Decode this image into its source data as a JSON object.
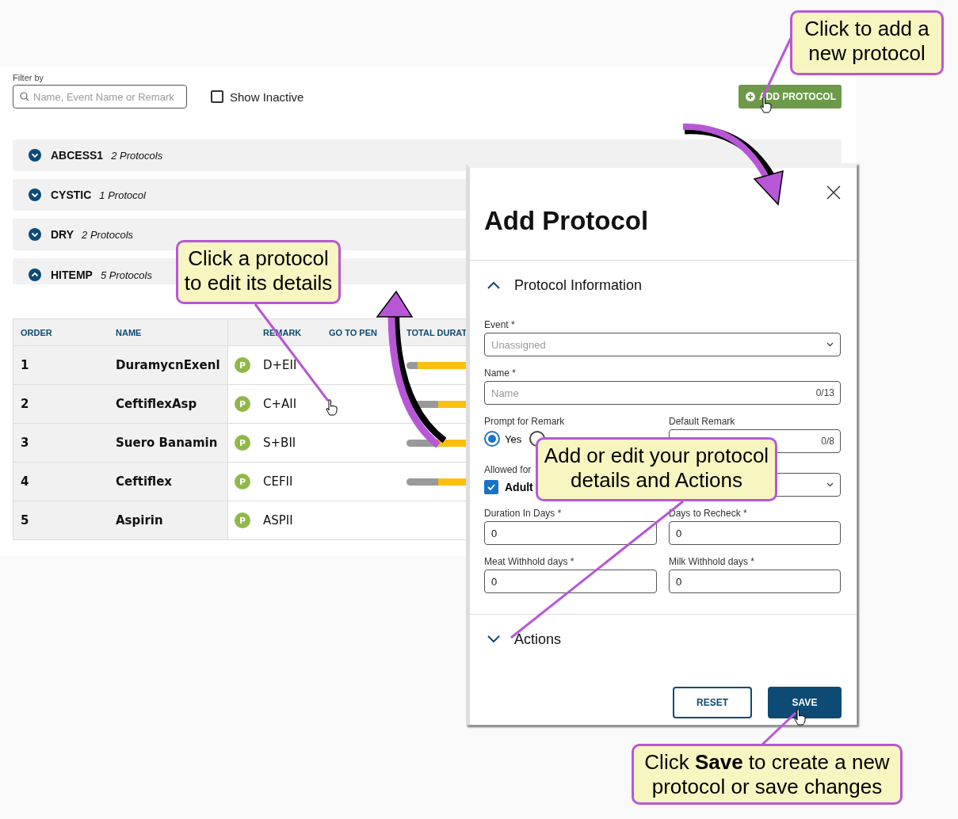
{
  "filter": {
    "label": "Filter by",
    "placeholder": "Name, Event Name or Remark"
  },
  "show_inactive": {
    "label": "Show Inactive",
    "checked": false
  },
  "add_button": "ADD PROTOCOL",
  "groups": [
    {
      "name": "ABCESS1",
      "count": "2 Protocols",
      "expanded": false
    },
    {
      "name": "CYSTIC",
      "count": "1 Protocol",
      "expanded": false
    },
    {
      "name": "DRY",
      "count": "2 Protocols",
      "expanded": false
    },
    {
      "name": "HITEMP",
      "count": "5 Protocols",
      "expanded": true
    }
  ],
  "table": {
    "columns": [
      "ORDER",
      "NAME",
      "REMARK",
      "GO TO PEN",
      "TOTAL DURAT"
    ],
    "rows": [
      {
        "order": "1",
        "name": "DuramycnExenl",
        "badge": "P",
        "remark": "D+EII",
        "duration_bar": true
      },
      {
        "order": "2",
        "name": "CeftiflexAsp",
        "badge": "P",
        "remark": "C+AII",
        "duration_bar": true
      },
      {
        "order": "3",
        "name": "Suero Banamin",
        "badge": "P",
        "remark": "S+BII",
        "duration_bar": true
      },
      {
        "order": "4",
        "name": "Ceftiflex",
        "badge": "P",
        "remark": "CEFII",
        "duration_bar": true
      },
      {
        "order": "5",
        "name": "Aspirin",
        "badge": "P",
        "remark": "ASPII",
        "duration_bar": false
      }
    ]
  },
  "dialog": {
    "title": "Add Protocol",
    "sections": [
      {
        "title": "Protocol Information",
        "expanded": true
      },
      {
        "title": "Actions",
        "expanded": false
      }
    ],
    "event": {
      "label": "Event *",
      "placeholder": "Unassigned"
    },
    "name": {
      "label": "Name *",
      "placeholder": "Name",
      "counter": "0/13"
    },
    "prompt_for_remark": {
      "label": "Prompt for Remark",
      "options": [
        {
          "label": "Yes",
          "selected": true
        },
        {
          "selected": false
        }
      ]
    },
    "default_remark": {
      "label": "Default Remark",
      "counter": "0/8"
    },
    "allowed_for": {
      "label": "Allowed for",
      "options": [
        {
          "label": "Adult",
          "checked": true
        }
      ]
    },
    "numbers": [
      {
        "label": "Duration In Days *",
        "value": "0"
      },
      {
        "label": "Days to Recheck *",
        "value": "0"
      },
      {
        "label": "Meat Withhold days *",
        "value": "0"
      },
      {
        "label": "Milk Withhold days *",
        "value": "0"
      }
    ],
    "buttons": [
      {
        "label": "RESET",
        "kind": "outline"
      },
      {
        "label": "SAVE",
        "kind": "primary"
      }
    ]
  },
  "callouts": [
    "Click to add a new protocol",
    "Click a protocol to edit its details",
    "Add or edit your protocol details and Actions",
    "Click **Save** to create a new protocol or save changes"
  ]
}
